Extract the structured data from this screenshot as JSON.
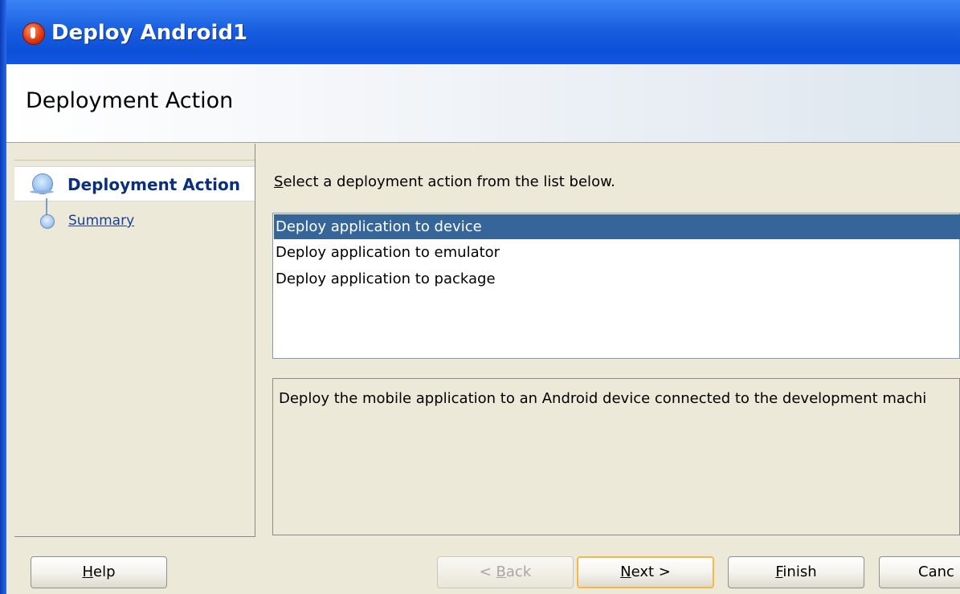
{
  "window": {
    "title": "Deploy Android1",
    "icon": "oracle-jdeveloper-icon"
  },
  "header": {
    "title": "Deployment Action"
  },
  "nav": {
    "steps": [
      {
        "label": "Deployment Action",
        "active": true,
        "icon": "step-active-icon"
      },
      {
        "label": "Summary",
        "active": false,
        "icon": "step-pending-icon"
      }
    ]
  },
  "main": {
    "instruction": "elect a deployment action from the list below.",
    "instruction_mnemonic": "S",
    "actions": [
      {
        "label": "Deploy application to device",
        "selected": true
      },
      {
        "label": "Deploy application to emulator",
        "selected": false
      },
      {
        "label": "Deploy application to package",
        "selected": false
      }
    ],
    "description": "Deploy the mobile application to an Android device connected to the development machi"
  },
  "buttons": {
    "help": {
      "mnemonic": "H",
      "rest": "elp"
    },
    "back": {
      "prefix": "< ",
      "mnemonic": "B",
      "rest": "ack",
      "disabled": true
    },
    "next": {
      "mnemonic": "N",
      "rest": "ext >",
      "focused": true
    },
    "finish": {
      "mnemonic": "F",
      "rest": "inish"
    },
    "cancel": {
      "label": "Canc"
    }
  },
  "colors": {
    "selection": "#366699",
    "titlebar": "#1a5fe0",
    "link": "#1b3f93",
    "focus_ring": "#f6b74a"
  }
}
